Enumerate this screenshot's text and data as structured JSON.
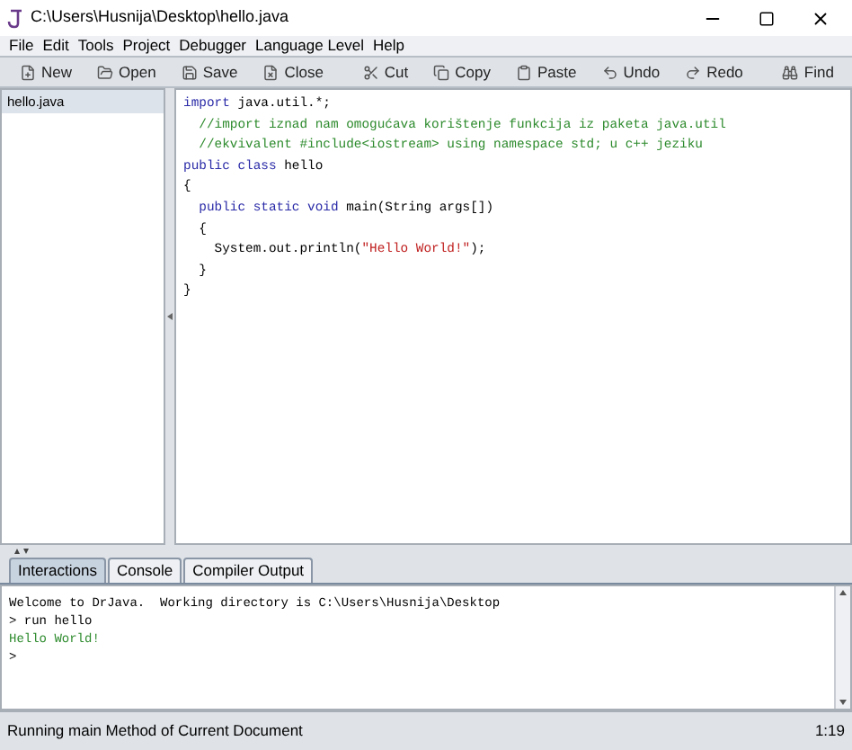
{
  "window": {
    "title": "C:\\Users\\Husnija\\Desktop\\hello.java"
  },
  "menu": [
    "File",
    "Edit",
    "Tools",
    "Project",
    "Debugger",
    "Language Level",
    "Help"
  ],
  "toolbar": [
    {
      "label": "New",
      "kind": "new"
    },
    {
      "label": "Open",
      "kind": "open"
    },
    {
      "label": "Save",
      "kind": "save"
    },
    {
      "label": "Close",
      "kind": "close"
    },
    {
      "label": "Cut",
      "kind": "cut"
    },
    {
      "label": "Copy",
      "kind": "copy"
    },
    {
      "label": "Paste",
      "kind": "paste"
    },
    {
      "label": "Undo",
      "kind": "undo"
    },
    {
      "label": "Redo",
      "kind": "redo"
    },
    {
      "label": "Find",
      "kind": "find"
    }
  ],
  "documents": [
    {
      "name": "hello.java",
      "selected": true
    }
  ],
  "code": [
    [
      {
        "kind": "keyword",
        "text": "import"
      },
      {
        "kind": "plain",
        "text": " java.util.*;"
      }
    ],
    [
      {
        "kind": "comment",
        "text": "  //import iznad nam omogućava korištenje funkcija iz paketa java.util"
      }
    ],
    [
      {
        "kind": "comment",
        "text": "  //ekvivalent #include<iostream> using namespace std; u c++ jeziku"
      }
    ],
    [
      {
        "kind": "keyword",
        "text": "public class"
      },
      {
        "kind": "plain",
        "text": " hello"
      }
    ],
    [
      {
        "kind": "plain",
        "text": "{"
      }
    ],
    [
      {
        "kind": "keyword",
        "text": "  public static void"
      },
      {
        "kind": "plain",
        "text": " main(String args[])"
      }
    ],
    [
      {
        "kind": "plain",
        "text": "  {"
      }
    ],
    [
      {
        "kind": "plain",
        "text": "    System.out.println("
      },
      {
        "kind": "string",
        "text": "\"Hello World!\""
      },
      {
        "kind": "plain",
        "text": ");"
      }
    ],
    [
      {
        "kind": "plain",
        "text": "  }"
      }
    ],
    [
      {
        "kind": "plain",
        "text": "}"
      }
    ]
  ],
  "tabs": [
    {
      "label": "Interactions",
      "selected": true
    },
    {
      "label": "Console",
      "selected": false
    },
    {
      "label": "Compiler Output",
      "selected": false
    }
  ],
  "interactions": [
    {
      "kind": "plain",
      "text": "Welcome to DrJava.  Working directory is C:\\Users\\Husnija\\Desktop"
    },
    {
      "kind": "plain",
      "text": "> run hello"
    },
    {
      "kind": "output",
      "text": "Hello World!"
    },
    {
      "kind": "plain",
      "text": ">"
    }
  ],
  "status_bar": {
    "message": "Running main Method of Current Document",
    "position": "1:19"
  }
}
